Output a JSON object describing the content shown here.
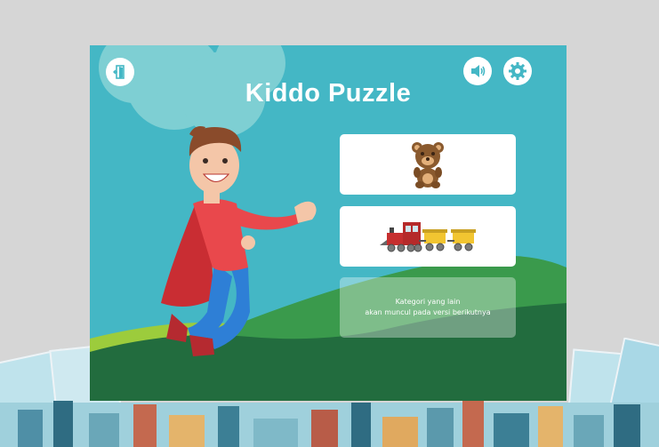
{
  "app": {
    "title": "Kiddo Puzzle"
  },
  "toolbar": {
    "exit_icon": "exit-door-icon",
    "sound_icon": "speaker-icon",
    "settings_icon": "gear-icon"
  },
  "categories": [
    {
      "id": "teddy-bear",
      "icon": "teddy-bear-icon"
    },
    {
      "id": "train",
      "icon": "train-icon"
    }
  ],
  "coming_soon": {
    "line1": "Kategori yang lain",
    "line2": "akan muncul pada versi berikutnya"
  },
  "colors": {
    "sky": "#44b7c5",
    "cloud": "#7ecfd3",
    "hill_light": "#9ccc3c",
    "hill_mid": "#3a9a4c",
    "hill_dark": "#226c3e",
    "background": "#d6d6d6"
  }
}
